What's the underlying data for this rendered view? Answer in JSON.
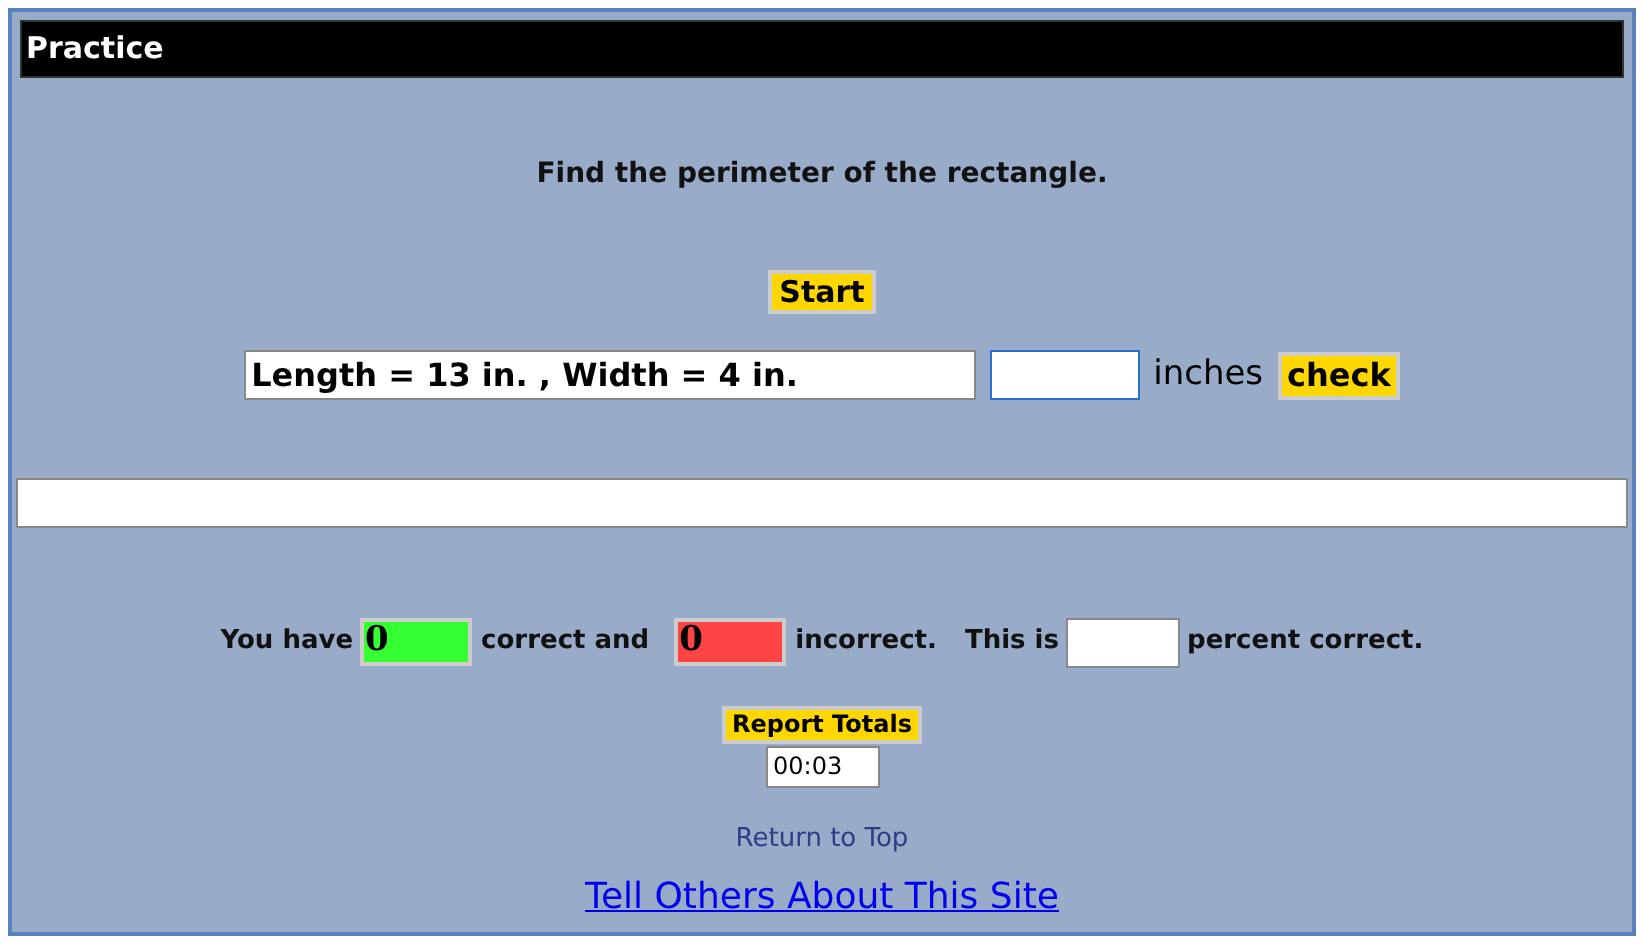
{
  "title": "Practice",
  "instruction": "Find the perimeter of the rectangle.",
  "start_button": "Start",
  "question": {
    "value": "Length = 13 in. , Width = 4 in."
  },
  "answer": {
    "unit": "inches"
  },
  "check_button": "check",
  "score": {
    "counters": [
      {
        "label": "You have",
        "value": "0",
        "color": "#33ff33"
      },
      {
        "label": "correct and",
        "value": "0",
        "color": "#ff4444"
      }
    ],
    "suffix": "incorrect.",
    "percent_prefix": "This is",
    "percent_suffix": "percent correct."
  },
  "report_button": "Report Totals",
  "timer": "00:03",
  "return_link": "Return to Top",
  "share_link": "Tell Others About This Site"
}
